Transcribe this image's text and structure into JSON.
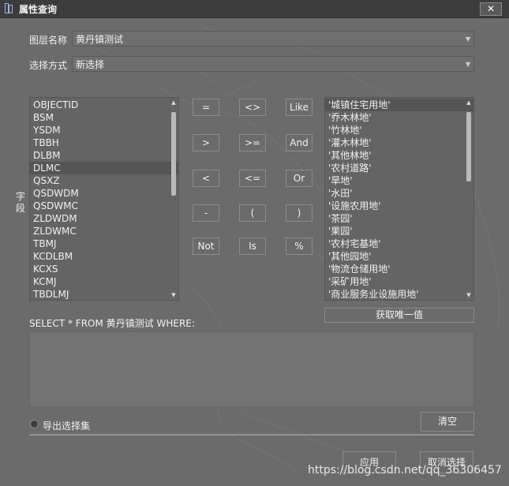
{
  "window": {
    "title": "属性查询",
    "close_label": "✕"
  },
  "layer": {
    "label": "图层名称",
    "value": "黄丹镇测试"
  },
  "mode": {
    "label": "选择方式",
    "value": "新选择"
  },
  "fields": {
    "label": "字段",
    "items": [
      "OBJECTID",
      "BSM",
      "YSDM",
      "TBBH",
      "DLBM",
      "DLMC",
      "QSXZ",
      "QSDWDM",
      "QSDWMC",
      "ZLDWDM",
      "ZLDWMC",
      "TBMJ",
      "KCDLBM",
      "KCXS",
      "KCMJ",
      "TBDLMJ"
    ],
    "selected": "DLMC"
  },
  "operators": [
    [
      "=",
      "<>",
      "Like"
    ],
    [
      ">",
      ">=",
      "And"
    ],
    [
      "<",
      "<=",
      "Or"
    ],
    [
      "-",
      "(",
      ")"
    ],
    [
      "Not",
      "Is",
      "%"
    ]
  ],
  "values": {
    "items": [
      "'城镇住宅用地'",
      "'乔木林地'",
      "'竹林地'",
      "'灌木林地'",
      "'其他林地'",
      "'农村道路'",
      "'旱地'",
      "'水田'",
      "'设施农用地'",
      "'茶园'",
      "'果园'",
      "'农村宅基地'",
      "'其他园地'",
      "'物流仓储用地'",
      "'采矿用地'",
      "'商业服务业设施用地'"
    ],
    "selected": "'城镇住宅用地'",
    "unique_button": "获取唯一值"
  },
  "sql": {
    "prefix": "SELECT * FROM 黄丹镇测试 WHERE:",
    "value": ""
  },
  "export": {
    "label": "导出选择集"
  },
  "buttons": {
    "clear": "清空",
    "apply": "应用",
    "cancel": "取消选择"
  },
  "watermark": "https://blog.csdn.net/qq_36306457"
}
